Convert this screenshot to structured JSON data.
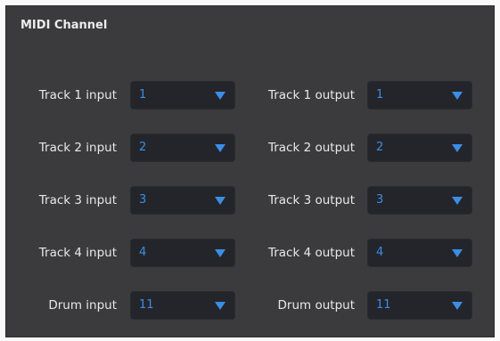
{
  "panel": {
    "title": "MIDI Channel",
    "accent_color": "#3a8ee6",
    "rows": [
      {
        "input_label": "Track 1 input",
        "input_value": "1",
        "output_label": "Track 1 output",
        "output_value": "1"
      },
      {
        "input_label": "Track 2 input",
        "input_value": "2",
        "output_label": "Track 2 output",
        "output_value": "2"
      },
      {
        "input_label": "Track 3 input",
        "input_value": "3",
        "output_label": "Track 3 output",
        "output_value": "3"
      },
      {
        "input_label": "Track 4 input",
        "input_value": "4",
        "output_label": "Track 4 output",
        "output_value": "4"
      },
      {
        "input_label": "Drum input",
        "input_value": "11",
        "output_label": "Drum output",
        "output_value": "11"
      }
    ],
    "dropdown_icon": "triangle-down"
  }
}
